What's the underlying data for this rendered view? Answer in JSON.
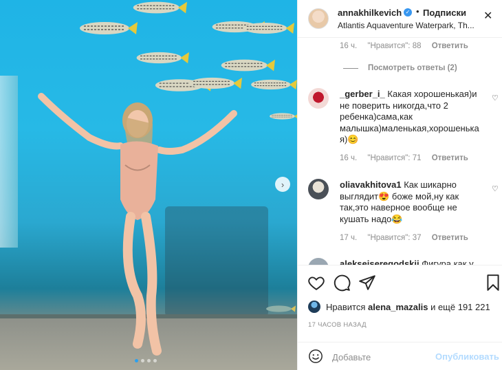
{
  "post": {
    "username": "annakhilkevich",
    "bullet": "•",
    "follow_label": "Подписки",
    "location": "Atlantis Aquaventure Waterpark, Th..."
  },
  "media": {
    "slide_count": 4,
    "active_slide": 1
  },
  "comments": {
    "top_meta": {
      "time": "16 ч.",
      "likes": "\"Нравится\": 88",
      "reply": "Ответить"
    },
    "view_replies": "Посмотреть ответы (2)",
    "items": [
      {
        "user": "_gerber_i_",
        "text_lines": [
          "Какая хорошенькая)и",
          "не поверить никогда,что 2",
          "ребенка)сама,как",
          "малышка)маленькая,хорошенька",
          "я)😊"
        ],
        "time": "16 ч.",
        "likes": "\"Нравится\": 71",
        "reply": "Ответить"
      },
      {
        "user": "oliavakhitova1",
        "text_lines": [
          "Как шикарно",
          "выглядит😍 боже мой,ну как",
          "так,это наверное вообще не",
          "кушать надо😂"
        ],
        "time": "17 ч.",
        "likes": "\"Нравится\": 37",
        "reply": "Ответить"
      },
      {
        "user": "alekseiseregodskii",
        "text_lines": [
          "Фигура как у"
        ]
      }
    ]
  },
  "likes": {
    "prefix": "Нравится",
    "user": "alena_mazalis",
    "suffix": "и ещё 191 221"
  },
  "timeago": "17 ЧАСОВ НАЗАД",
  "comment_box": {
    "placeholder": "Добавьте",
    "publish_label": "Опубликовать"
  },
  "colors": {
    "accent": "#3897f0",
    "publish_disabled": "#b3dbff",
    "water": "#27b9e6"
  }
}
